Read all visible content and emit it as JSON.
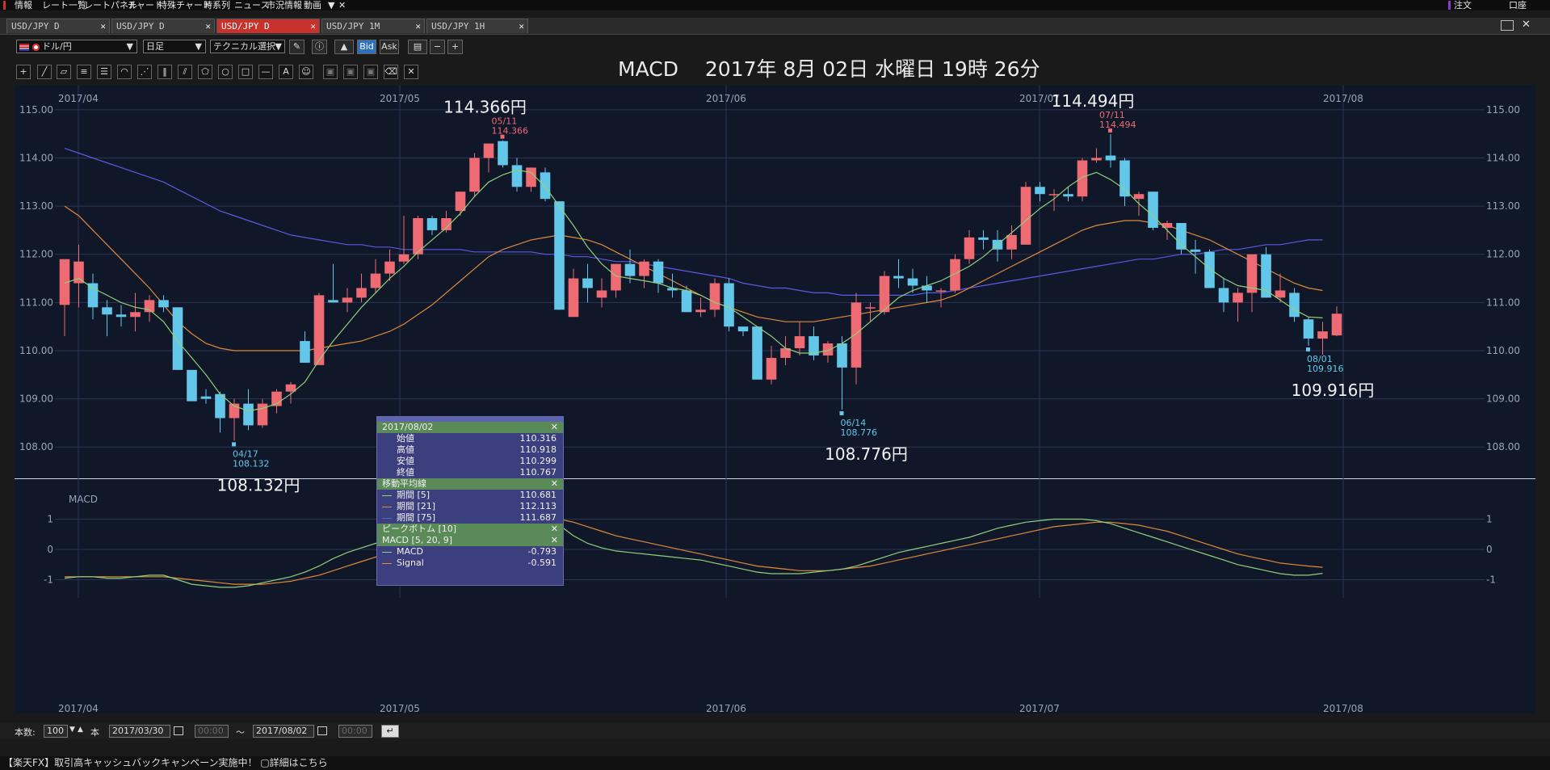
{
  "menubar": {
    "items": [
      "情報",
      "レート一覧",
      "レートパネル",
      "チャート",
      "特殊チャート",
      "時系列",
      "ニュース",
      "市況情報",
      "動画",
      "▼",
      "✕"
    ],
    "right_items": [
      "注文",
      "口座"
    ]
  },
  "tabs": [
    {
      "label": "USD/JPY D",
      "active": false
    },
    {
      "label": "USD/JPY D",
      "active": false
    },
    {
      "label": "USD/JPY D",
      "active": true
    },
    {
      "label": "USD/JPY 1M",
      "active": false
    },
    {
      "label": "USD/JPY 1H",
      "active": false
    }
  ],
  "toolbar": {
    "currency": "ドル/円",
    "timeframe": "日足",
    "technical": "テクニカル選択",
    "bid": "Bid",
    "ask": "Ask"
  },
  "header": {
    "title": "MACD　 2017年 8月 02日 水曜日 19時 26分"
  },
  "colors": {
    "bull": "#ef6b73",
    "bear": "#63c7ea",
    "ma5": "#8fd07a",
    "ma21": "#e08a3a",
    "ma75": "#5a5ae0",
    "macd": "#8fd07a",
    "signal": "#e08a3a",
    "grid": "#2b3552",
    "bg": "#0f1729"
  },
  "chart_data": {
    "type": "candlestick",
    "symbol": "USD/JPY D",
    "x_labels": [
      "2017/04",
      "2017/05",
      "2017/06",
      "2017/07",
      "2017/08"
    ],
    "ylim": [
      107.35,
      115.35
    ],
    "y_ticks": [
      "115.00",
      "114.00",
      "113.00",
      "112.00",
      "111.00",
      "110.00",
      "109.00",
      "108.00"
    ],
    "candles": [
      {
        "o": 110.95,
        "h": 111.8,
        "l": 110.3,
        "c": 111.9
      },
      {
        "o": 111.4,
        "h": 112.2,
        "l": 110.9,
        "c": 111.85
      },
      {
        "o": 111.4,
        "h": 111.6,
        "l": 110.65,
        "c": 110.9
      },
      {
        "o": 110.9,
        "h": 111.05,
        "l": 110.3,
        "c": 110.75
      },
      {
        "o": 110.75,
        "h": 110.95,
        "l": 110.5,
        "c": 110.7
      },
      {
        "o": 110.7,
        "h": 111.2,
        "l": 110.4,
        "c": 110.8
      },
      {
        "o": 110.8,
        "h": 111.15,
        "l": 110.6,
        "c": 111.05
      },
      {
        "o": 111.05,
        "h": 111.15,
        "l": 110.8,
        "c": 110.9
      },
      {
        "o": 110.9,
        "h": 110.9,
        "l": 109.6,
        "c": 109.6
      },
      {
        "o": 109.6,
        "h": 109.6,
        "l": 108.95,
        "c": 108.95
      },
      {
        "o": 109.05,
        "h": 109.2,
        "l": 108.9,
        "c": 109.0
      },
      {
        "o": 109.1,
        "h": 109.15,
        "l": 108.3,
        "c": 108.6
      },
      {
        "o": 108.6,
        "h": 109.0,
        "l": 108.132,
        "c": 108.9
      },
      {
        "o": 108.9,
        "h": 109.2,
        "l": 108.35,
        "c": 108.45
      },
      {
        "o": 108.45,
        "h": 109.0,
        "l": 108.4,
        "c": 108.9
      },
      {
        "o": 108.85,
        "h": 109.2,
        "l": 108.7,
        "c": 109.15
      },
      {
        "o": 109.15,
        "h": 109.35,
        "l": 108.9,
        "c": 109.3
      },
      {
        "o": 110.2,
        "h": 110.4,
        "l": 109.75,
        "c": 109.75
      },
      {
        "o": 109.7,
        "h": 111.2,
        "l": 109.7,
        "c": 111.15
      },
      {
        "o": 111.05,
        "h": 111.8,
        "l": 111.0,
        "c": 111.0
      },
      {
        "o": 111.0,
        "h": 111.3,
        "l": 110.8,
        "c": 111.1
      },
      {
        "o": 111.1,
        "h": 111.6,
        "l": 111.0,
        "c": 111.3
      },
      {
        "o": 111.3,
        "h": 111.9,
        "l": 111.2,
        "c": 111.6
      },
      {
        "o": 111.6,
        "h": 112.1,
        "l": 111.45,
        "c": 111.85
      },
      {
        "o": 111.85,
        "h": 112.8,
        "l": 111.8,
        "c": 112.0
      },
      {
        "o": 112.0,
        "h": 112.8,
        "l": 111.9,
        "c": 112.75
      },
      {
        "o": 112.75,
        "h": 112.8,
        "l": 112.4,
        "c": 112.5
      },
      {
        "o": 112.5,
        "h": 112.9,
        "l": 112.45,
        "c": 112.75
      },
      {
        "o": 112.9,
        "h": 113.3,
        "l": 112.8,
        "c": 113.3
      },
      {
        "o": 113.3,
        "h": 114.1,
        "l": 113.2,
        "c": 114.0
      },
      {
        "o": 114.0,
        "h": 114.3,
        "l": 113.7,
        "c": 114.3
      },
      {
        "o": 114.35,
        "h": 114.366,
        "l": 113.8,
        "c": 113.85
      },
      {
        "o": 113.85,
        "h": 114.0,
        "l": 113.3,
        "c": 113.4
      },
      {
        "o": 113.4,
        "h": 113.8,
        "l": 113.3,
        "c": 113.8
      },
      {
        "o": 113.7,
        "h": 113.8,
        "l": 113.1,
        "c": 113.15
      },
      {
        "o": 113.1,
        "h": 113.1,
        "l": 110.85,
        "c": 110.85
      },
      {
        "o": 110.7,
        "h": 111.7,
        "l": 110.7,
        "c": 111.5
      },
      {
        "o": 111.5,
        "h": 111.8,
        "l": 111.0,
        "c": 111.3
      },
      {
        "o": 111.1,
        "h": 111.5,
        "l": 110.9,
        "c": 111.25
      },
      {
        "o": 111.25,
        "h": 111.8,
        "l": 111.1,
        "c": 111.8
      },
      {
        "o": 111.8,
        "h": 112.1,
        "l": 111.4,
        "c": 111.55
      },
      {
        "o": 111.55,
        "h": 111.9,
        "l": 111.3,
        "c": 111.85
      },
      {
        "o": 111.85,
        "h": 111.9,
        "l": 111.2,
        "c": 111.4
      },
      {
        "o": 111.3,
        "h": 111.6,
        "l": 111.1,
        "c": 111.25
      },
      {
        "o": 111.25,
        "h": 111.35,
        "l": 110.8,
        "c": 110.8
      },
      {
        "o": 110.8,
        "h": 111.1,
        "l": 110.7,
        "c": 110.85
      },
      {
        "o": 110.85,
        "h": 111.5,
        "l": 110.7,
        "c": 111.4
      },
      {
        "o": 111.4,
        "h": 111.5,
        "l": 110.4,
        "c": 110.5
      },
      {
        "o": 110.5,
        "h": 110.5,
        "l": 110.3,
        "c": 110.4
      },
      {
        "o": 110.5,
        "h": 110.5,
        "l": 109.4,
        "c": 109.4
      },
      {
        "o": 109.4,
        "h": 110.1,
        "l": 109.3,
        "c": 109.85
      },
      {
        "o": 109.85,
        "h": 110.3,
        "l": 109.7,
        "c": 110.05
      },
      {
        "o": 110.05,
        "h": 110.6,
        "l": 109.9,
        "c": 110.3
      },
      {
        "o": 110.3,
        "h": 110.5,
        "l": 109.8,
        "c": 109.9
      },
      {
        "o": 109.9,
        "h": 110.2,
        "l": 109.75,
        "c": 110.15
      },
      {
        "o": 110.15,
        "h": 110.3,
        "l": 108.776,
        "c": 109.65
      },
      {
        "o": 109.65,
        "h": 111.2,
        "l": 109.3,
        "c": 111.0
      },
      {
        "o": 110.9,
        "h": 111.0,
        "l": 110.6,
        "c": 110.9
      },
      {
        "o": 110.8,
        "h": 111.65,
        "l": 110.75,
        "c": 111.55
      },
      {
        "o": 111.55,
        "h": 111.9,
        "l": 111.3,
        "c": 111.5
      },
      {
        "o": 111.5,
        "h": 111.7,
        "l": 111.2,
        "c": 111.35
      },
      {
        "o": 111.35,
        "h": 111.55,
        "l": 111.0,
        "c": 111.25
      },
      {
        "o": 111.25,
        "h": 111.3,
        "l": 110.9,
        "c": 111.25
      },
      {
        "o": 111.25,
        "h": 112.0,
        "l": 111.2,
        "c": 111.9
      },
      {
        "o": 111.9,
        "h": 112.5,
        "l": 111.8,
        "c": 112.35
      },
      {
        "o": 112.35,
        "h": 112.5,
        "l": 112.1,
        "c": 112.3
      },
      {
        "o": 112.3,
        "h": 112.5,
        "l": 111.85,
        "c": 112.1
      },
      {
        "o": 112.1,
        "h": 112.6,
        "l": 111.9,
        "c": 112.4
      },
      {
        "o": 112.2,
        "h": 113.5,
        "l": 112.2,
        "c": 113.4
      },
      {
        "o": 113.4,
        "h": 113.5,
        "l": 113.1,
        "c": 113.25
      },
      {
        "o": 113.25,
        "h": 113.35,
        "l": 112.9,
        "c": 113.25
      },
      {
        "o": 113.25,
        "h": 113.4,
        "l": 113.1,
        "c": 113.2
      },
      {
        "o": 113.2,
        "h": 114.0,
        "l": 113.1,
        "c": 113.95
      },
      {
        "o": 113.95,
        "h": 114.2,
        "l": 113.9,
        "c": 114.0
      },
      {
        "o": 114.05,
        "h": 114.494,
        "l": 113.8,
        "c": 113.95
      },
      {
        "o": 113.95,
        "h": 114.0,
        "l": 113.0,
        "c": 113.2
      },
      {
        "o": 113.15,
        "h": 113.3,
        "l": 112.8,
        "c": 113.25
      },
      {
        "o": 113.3,
        "h": 113.3,
        "l": 112.5,
        "c": 112.55
      },
      {
        "o": 112.55,
        "h": 112.7,
        "l": 112.3,
        "c": 112.65
      },
      {
        "o": 112.65,
        "h": 112.65,
        "l": 112.0,
        "c": 112.1
      },
      {
        "o": 112.1,
        "h": 112.3,
        "l": 111.6,
        "c": 112.05
      },
      {
        "o": 112.05,
        "h": 112.1,
        "l": 111.3,
        "c": 111.3
      },
      {
        "o": 111.3,
        "h": 111.5,
        "l": 110.8,
        "c": 111.0
      },
      {
        "o": 111.0,
        "h": 111.3,
        "l": 110.6,
        "c": 111.2
      },
      {
        "o": 111.2,
        "h": 112.0,
        "l": 110.8,
        "c": 112.0
      },
      {
        "o": 112.0,
        "h": 112.15,
        "l": 111.1,
        "c": 111.1
      },
      {
        "o": 111.1,
        "h": 111.6,
        "l": 111.0,
        "c": 111.25
      },
      {
        "o": 111.2,
        "h": 111.3,
        "l": 110.6,
        "c": 110.7
      },
      {
        "o": 110.65,
        "h": 110.7,
        "l": 110.1,
        "c": 110.25
      },
      {
        "o": 110.25,
        "h": 110.6,
        "l": 109.916,
        "c": 110.4
      },
      {
        "o": 110.316,
        "h": 110.918,
        "l": 110.299,
        "c": 110.767
      }
    ],
    "ma5": [
      111.4,
      111.5,
      111.3,
      111.15,
      111.0,
      110.9,
      110.85,
      110.6,
      110.2,
      109.85,
      109.5,
      109.1,
      108.85,
      108.75,
      108.8,
      108.9,
      109.1,
      109.35,
      109.8,
      110.2,
      110.55,
      110.9,
      111.2,
      111.5,
      111.75,
      112.05,
      112.3,
      112.55,
      112.85,
      113.2,
      113.5,
      113.65,
      113.75,
      113.7,
      113.4,
      113.0,
      112.6,
      112.15,
      111.8,
      111.55,
      111.5,
      111.45,
      111.4,
      111.3,
      111.25,
      111.15,
      111.0,
      110.9,
      110.7,
      110.5,
      110.3,
      110.05,
      109.95,
      109.95,
      110.0,
      110.15,
      110.35,
      110.6,
      110.85,
      111.1,
      111.25,
      111.35,
      111.45,
      111.6,
      111.75,
      111.95,
      112.2,
      112.45,
      112.7,
      112.95,
      113.15,
      113.4,
      113.6,
      113.7,
      113.55,
      113.35,
      113.05,
      112.8,
      112.5,
      112.2,
      111.95,
      111.7,
      111.5,
      111.35,
      111.3,
      111.25,
      111.05,
      110.85,
      110.7,
      110.68
    ],
    "ma21": [
      113.0,
      112.8,
      112.5,
      112.2,
      111.9,
      111.6,
      111.3,
      110.95,
      110.6,
      110.35,
      110.15,
      110.05,
      110.0,
      110.0,
      110.0,
      110.0,
      110.0,
      110.0,
      110.05,
      110.1,
      110.15,
      110.2,
      110.3,
      110.4,
      110.55,
      110.75,
      110.95,
      111.2,
      111.45,
      111.7,
      111.95,
      112.1,
      112.2,
      112.3,
      112.35,
      112.4,
      112.35,
      112.3,
      112.2,
      112.05,
      111.9,
      111.75,
      111.6,
      111.45,
      111.3,
      111.15,
      111.0,
      110.9,
      110.8,
      110.7,
      110.65,
      110.6,
      110.6,
      110.6,
      110.65,
      110.7,
      110.75,
      110.8,
      110.85,
      110.9,
      110.95,
      111.0,
      111.05,
      111.15,
      111.3,
      111.45,
      111.6,
      111.75,
      111.9,
      112.05,
      112.2,
      112.35,
      112.5,
      112.6,
      112.65,
      112.7,
      112.7,
      112.65,
      112.6,
      112.5,
      112.4,
      112.3,
      112.15,
      112.0,
      111.85,
      111.7,
      111.55,
      111.4,
      111.3,
      111.25
    ],
    "ma75": [
      114.2,
      114.1,
      114.0,
      113.9,
      113.8,
      113.7,
      113.6,
      113.5,
      113.35,
      113.2,
      113.05,
      112.9,
      112.8,
      112.7,
      112.6,
      112.5,
      112.4,
      112.35,
      112.3,
      112.25,
      112.2,
      112.2,
      112.15,
      112.15,
      112.1,
      112.1,
      112.1,
      112.1,
      112.1,
      112.05,
      112.05,
      112.05,
      112.05,
      112.05,
      112.0,
      112.0,
      111.95,
      111.95,
      111.9,
      111.85,
      111.85,
      111.8,
      111.75,
      111.7,
      111.65,
      111.6,
      111.55,
      111.5,
      111.4,
      111.35,
      111.3,
      111.3,
      111.25,
      111.2,
      111.2,
      111.15,
      111.15,
      111.15,
      111.15,
      111.15,
      111.15,
      111.2,
      111.2,
      111.25,
      111.3,
      111.35,
      111.4,
      111.45,
      111.5,
      111.55,
      111.6,
      111.65,
      111.7,
      111.75,
      111.8,
      111.85,
      111.9,
      111.9,
      111.95,
      112.0,
      112.0,
      112.05,
      112.1,
      112.1,
      112.15,
      112.2,
      112.2,
      112.25,
      112.3,
      112.3
    ],
    "macd_ylim": [
      -1.6,
      2.0
    ],
    "macd_ticks": [
      1,
      0,
      -1
    ],
    "macd": [
      -0.95,
      -0.9,
      -0.9,
      -0.95,
      -0.95,
      -0.9,
      -0.85,
      -0.85,
      -1.0,
      -1.15,
      -1.2,
      -1.25,
      -1.25,
      -1.2,
      -1.1,
      -1.0,
      -0.9,
      -0.75,
      -0.55,
      -0.3,
      -0.1,
      0.05,
      0.2,
      0.3,
      0.45,
      0.6,
      0.75,
      0.85,
      0.95,
      1.1,
      1.3,
      1.45,
      1.5,
      1.45,
      1.2,
      0.8,
      0.45,
      0.2,
      0.05,
      -0.05,
      -0.1,
      -0.15,
      -0.2,
      -0.25,
      -0.3,
      -0.35,
      -0.45,
      -0.55,
      -0.65,
      -0.75,
      -0.8,
      -0.8,
      -0.8,
      -0.75,
      -0.7,
      -0.65,
      -0.55,
      -0.4,
      -0.25,
      -0.1,
      0.0,
      0.1,
      0.2,
      0.3,
      0.4,
      0.55,
      0.7,
      0.8,
      0.9,
      0.95,
      1.0,
      1.0,
      1.0,
      0.95,
      0.85,
      0.7,
      0.55,
      0.4,
      0.25,
      0.1,
      -0.05,
      -0.2,
      -0.35,
      -0.5,
      -0.6,
      -0.7,
      -0.8,
      -0.85,
      -0.85,
      -0.79
    ],
    "signal": [
      -0.9,
      -0.9,
      -0.9,
      -0.9,
      -0.9,
      -0.9,
      -0.9,
      -0.9,
      -0.95,
      -1.0,
      -1.05,
      -1.1,
      -1.15,
      -1.15,
      -1.15,
      -1.1,
      -1.05,
      -0.95,
      -0.85,
      -0.7,
      -0.55,
      -0.4,
      -0.25,
      -0.1,
      0.05,
      0.2,
      0.35,
      0.5,
      0.6,
      0.7,
      0.85,
      0.95,
      1.05,
      1.1,
      1.1,
      1.0,
      0.9,
      0.75,
      0.6,
      0.45,
      0.35,
      0.25,
      0.15,
      0.05,
      -0.05,
      -0.15,
      -0.25,
      -0.35,
      -0.45,
      -0.55,
      -0.6,
      -0.65,
      -0.7,
      -0.7,
      -0.7,
      -0.65,
      -0.6,
      -0.55,
      -0.45,
      -0.35,
      -0.25,
      -0.15,
      -0.05,
      0.05,
      0.15,
      0.25,
      0.35,
      0.45,
      0.55,
      0.65,
      0.75,
      0.8,
      0.85,
      0.9,
      0.9,
      0.85,
      0.8,
      0.7,
      0.6,
      0.45,
      0.3,
      0.15,
      0.0,
      -0.15,
      -0.25,
      -0.35,
      -0.45,
      -0.5,
      -0.55,
      -0.59
    ],
    "callouts": [
      {
        "idx": 31,
        "date": "05/11",
        "value": "114.366",
        "big": "114.366円",
        "pos": "high",
        "color": "#ef6b73"
      },
      {
        "idx": 74,
        "date": "07/11",
        "value": "114.494",
        "big": "114.494円",
        "pos": "high",
        "color": "#ef6b73"
      },
      {
        "idx": 12,
        "date": "04/17",
        "value": "108.132",
        "big": "108.132円",
        "pos": "low",
        "color": "#63c7ea"
      },
      {
        "idx": 55,
        "date": "06/14",
        "value": "108.776",
        "big": "108.776円",
        "pos": "low",
        "color": "#63c7ea"
      },
      {
        "idx": 88,
        "date": "08/01",
        "value": "109.916",
        "big": "109.916円",
        "pos": "low",
        "color": "#63c7ea"
      }
    ]
  },
  "info_panel": {
    "date": "2017/08/02",
    "ohlc": [
      {
        "label": "始値",
        "value": "110.316"
      },
      {
        "label": "高値",
        "value": "110.918"
      },
      {
        "label": "安値",
        "value": "110.299"
      },
      {
        "label": "終値",
        "value": "110.767"
      }
    ],
    "ma_title": "移動平均線",
    "ma": [
      {
        "label": "期間 [5]",
        "value": "110.681",
        "color": "#8fd07a"
      },
      {
        "label": "期間 [21]",
        "value": "112.113",
        "color": "#e08a3a"
      },
      {
        "label": "期間 [75]",
        "value": "111.687",
        "color": "#5a5ae0"
      }
    ],
    "peak_title": "ピークボトム [10]",
    "macd_title": "MACD [5, 20, 9]",
    "macd_rows": [
      {
        "label": "MACD",
        "value": "-0.793",
        "color": "#8fd07a"
      },
      {
        "label": "Signal",
        "value": "-0.591",
        "color": "#e08a3a"
      }
    ]
  },
  "macd_pane_label": "MACD",
  "bottom": {
    "count_label": "本数:",
    "count_value": "100",
    "unit": "本",
    "start_date": "2017/03/30",
    "start_time": "00:00",
    "tilde": "～",
    "end_date": "2017/08/02",
    "end_time": "00:00"
  },
  "statusbar": {
    "text": "【楽天FX】取引高キャッシュバックキャンペーン実施中！ ▢詳細はこちら"
  }
}
